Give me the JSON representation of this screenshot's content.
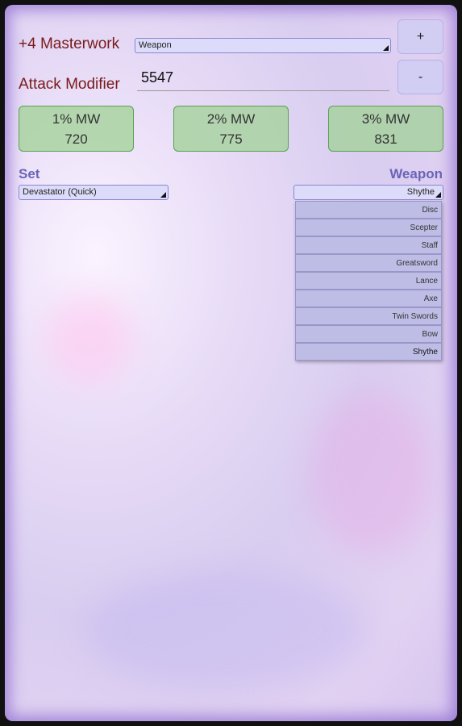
{
  "masterwork": {
    "label": "+4 Masterwork",
    "selected": "Weapon"
  },
  "buttons": {
    "plus": "+",
    "minus": "-"
  },
  "attack": {
    "label": "Attack Modifier",
    "value": "5547"
  },
  "cards": [
    {
      "title": "1% MW",
      "value": "720"
    },
    {
      "title": "2% MW",
      "value": "775"
    },
    {
      "title": "3% MW",
      "value": "831"
    }
  ],
  "set": {
    "label": "Set",
    "selected": "Devastator (Quick)"
  },
  "weapon": {
    "label": "Weapon",
    "selected": "Shythe",
    "options": [
      "Disc",
      "Scepter",
      "Staff",
      "Greatsword",
      "Lance",
      "Axe",
      "Twin Swords",
      "Bow",
      "Shythe"
    ]
  }
}
